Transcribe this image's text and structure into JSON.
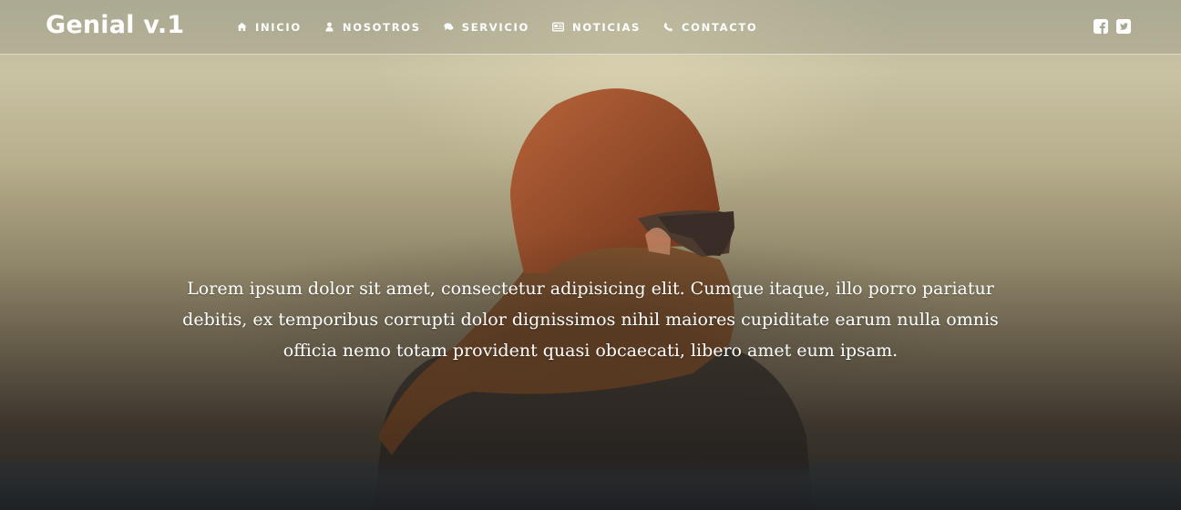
{
  "header": {
    "brand": "Genial v.1",
    "nav": [
      {
        "label": "INICIO",
        "icon": "home-icon"
      },
      {
        "label": "NOSOTROS",
        "icon": "user-icon"
      },
      {
        "label": "SERVICIO",
        "icon": "comments-icon"
      },
      {
        "label": "NOTICIAS",
        "icon": "newspaper-icon"
      },
      {
        "label": "CONTACTO",
        "icon": "phone-icon"
      }
    ],
    "social": [
      {
        "icon": "facebook-square-icon"
      },
      {
        "icon": "twitter-square-icon"
      }
    ]
  },
  "hero": {
    "text": "Lorem ipsum dolor sit amet, consectetur adipisicing elit. Cumque itaque, illo porro pariatur debitis, ex temporibus corrupti dolor dignissimos nihil maiores cupiditate earum nulla omnis officia nemo totam provident quasi obcaecati, libero amet eum ipsam."
  },
  "colors": {
    "text": "#ffffff",
    "header_overlay": "#96967f",
    "hair": "#a24f2a",
    "scarf": "#6b4325",
    "jacket": "#2b2622"
  }
}
